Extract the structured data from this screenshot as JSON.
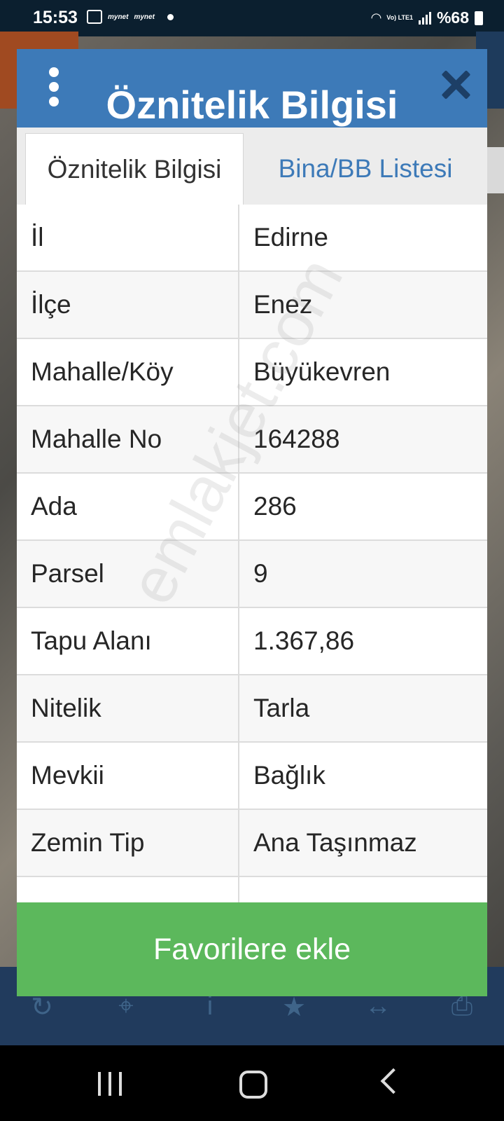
{
  "status_bar": {
    "time": "15:53",
    "app_notifications": [
      "mynet",
      "mynet"
    ],
    "lte_label": "Vo) LTE1",
    "battery_text": "%68"
  },
  "modal": {
    "title": "Öznitelik Bilgisi",
    "tabs": [
      {
        "label": "Öznitelik Bilgisi",
        "active": true
      },
      {
        "label": "Bina/BB Listesi",
        "active": false
      }
    ],
    "rows": [
      {
        "key": "İl",
        "value": "Edirne"
      },
      {
        "key": "İlçe",
        "value": "Enez"
      },
      {
        "key": "Mahalle/Köy",
        "value": "Büyükevren"
      },
      {
        "key": "Mahalle No",
        "value": "164288"
      },
      {
        "key": "Ada",
        "value": "286"
      },
      {
        "key": "Parsel",
        "value": "9"
      },
      {
        "key": "Tapu Alanı",
        "value": "1.367,86"
      },
      {
        "key": "Nitelik",
        "value": "Tarla"
      },
      {
        "key": "Mevkii",
        "value": "Bağlık"
      },
      {
        "key": "Zemin Tip",
        "value": "Ana Taşınmaz"
      }
    ],
    "favorite_button": "Favorilere ekle"
  },
  "watermark": "emlakjet.com",
  "toolbar_icons": [
    "refresh-icon",
    "crosshair-icon",
    "info-icon",
    "star-icon",
    "measure-icon",
    "print-icon"
  ],
  "colors": {
    "header_blue": "#3d7ab8",
    "favorite_green": "#5cb85c",
    "toolbar_navy": "#213b5d"
  }
}
